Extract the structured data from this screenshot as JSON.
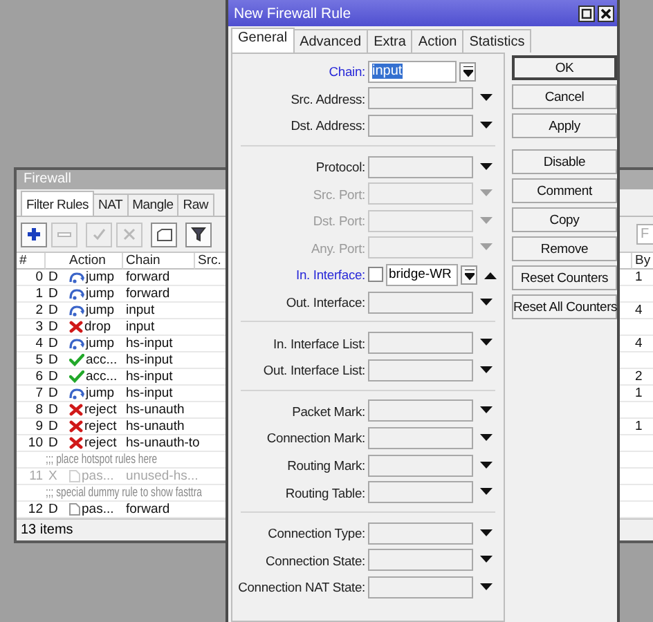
{
  "firewall": {
    "title": "Firewall",
    "tabs": [
      {
        "label": "Filter Rules",
        "selected": true
      },
      {
        "label": "NAT",
        "selected": false
      },
      {
        "label": "Mangle",
        "selected": false
      },
      {
        "label": "Raw",
        "selected": false
      }
    ],
    "toolbar": [
      {
        "kind": "add",
        "disabled": false
      },
      {
        "kind": "remove",
        "disabled": true
      },
      {
        "kind": "enable",
        "disabled": true
      },
      {
        "kind": "disable",
        "disabled": true
      },
      {
        "kind": "comment",
        "disabled": false
      },
      {
        "kind": "filter",
        "disabled": false
      }
    ],
    "find_placeholder": "F",
    "columns": [
      "#",
      "Action",
      "Chain",
      "Src.",
      "By"
    ],
    "rows": [
      {
        "kind": "rule",
        "number": "0",
        "flags": "D",
        "action": {
          "kind": "jump",
          "label": "jump"
        },
        "chain": "forward",
        "bytes": "1",
        "disabled": false
      },
      {
        "kind": "rule",
        "number": "1",
        "flags": "D",
        "action": {
          "kind": "jump",
          "label": "jump"
        },
        "chain": "forward",
        "disabled": false
      },
      {
        "kind": "rule",
        "number": "2",
        "flags": "D",
        "action": {
          "kind": "jump",
          "label": "jump"
        },
        "chain": "input",
        "bytes": "4",
        "disabled": false
      },
      {
        "kind": "rule",
        "number": "3",
        "flags": "D",
        "action": {
          "kind": "drop",
          "label": "drop"
        },
        "chain": "input",
        "disabled": false
      },
      {
        "kind": "rule",
        "number": "4",
        "flags": "D",
        "action": {
          "kind": "jump",
          "label": "jump"
        },
        "chain": "hs-input",
        "bytes": "4",
        "disabled": false
      },
      {
        "kind": "rule",
        "number": "5",
        "flags": "D",
        "action": {
          "kind": "accept",
          "label": "acc..."
        },
        "chain": "hs-input",
        "disabled": false
      },
      {
        "kind": "rule",
        "number": "6",
        "flags": "D",
        "action": {
          "kind": "accept",
          "label": "acc..."
        },
        "chain": "hs-input",
        "bytes": "2",
        "disabled": false
      },
      {
        "kind": "rule",
        "number": "7",
        "flags": "D",
        "action": {
          "kind": "jump",
          "label": "jump"
        },
        "chain": "hs-input",
        "bytes": "1",
        "disabled": false
      },
      {
        "kind": "rule",
        "number": "8",
        "flags": "D",
        "action": {
          "kind": "reject",
          "label": "reject"
        },
        "chain": "hs-unauth",
        "disabled": false
      },
      {
        "kind": "rule",
        "number": "9",
        "flags": "D",
        "action": {
          "kind": "reject",
          "label": "reject"
        },
        "chain": "hs-unauth",
        "bytes": "1",
        "disabled": false
      },
      {
        "kind": "rule",
        "number": "10",
        "flags": "D",
        "action": {
          "kind": "reject",
          "label": "reject"
        },
        "chain": "hs-unauth-to",
        "disabled": false
      },
      {
        "kind": "comment",
        "text": ";;; place hotspot rules here"
      },
      {
        "kind": "rule",
        "number": "11",
        "flags": "X",
        "action": {
          "kind": "passthrough",
          "label": "pas..."
        },
        "chain": "unused-hs...",
        "disabled": true
      },
      {
        "kind": "comment",
        "text": ";;; special dummy rule to show fasttra"
      },
      {
        "kind": "rule",
        "number": "12",
        "flags": "D",
        "action": {
          "kind": "passthrough",
          "label": "pas..."
        },
        "chain": "forward",
        "disabled": false
      }
    ],
    "status": "13 items"
  },
  "dialog": {
    "title": "New Firewall Rule",
    "tabs": [
      {
        "label": "General",
        "selected": true
      },
      {
        "label": "Advanced",
        "selected": false
      },
      {
        "label": "Extra",
        "selected": false
      },
      {
        "label": "Action",
        "selected": false
      },
      {
        "label": "Statistics",
        "selected": false
      }
    ],
    "groups": [
      [
        {
          "label": "Chain:",
          "kind": "select",
          "value": "input",
          "value_selected": true,
          "highlighted": true,
          "disabled": false
        },
        {
          "label": "Src. Address:",
          "kind": "combo",
          "highlighted": false,
          "disabled": false,
          "expanded": false
        },
        {
          "label": "Dst. Address:",
          "kind": "combo",
          "highlighted": false,
          "disabled": false,
          "expanded": false
        }
      ],
      [
        {
          "label": "Protocol:",
          "kind": "combo",
          "highlighted": false,
          "disabled": false,
          "expanded": false
        },
        {
          "label": "Src. Port:",
          "kind": "combo",
          "highlighted": false,
          "disabled": true,
          "expanded": false
        },
        {
          "label": "Dst. Port:",
          "kind": "combo",
          "highlighted": false,
          "disabled": true,
          "expanded": false
        },
        {
          "label": "Any. Port:",
          "kind": "combo",
          "highlighted": false,
          "disabled": true,
          "expanded": false
        },
        {
          "label": "In. Interface:",
          "kind": "negatable",
          "value": "bridge-WR",
          "negated": false,
          "highlighted": true,
          "disabled": false,
          "expanded": true
        },
        {
          "label": "Out. Interface:",
          "kind": "combo",
          "highlighted": false,
          "disabled": false,
          "expanded": false
        }
      ],
      [
        {
          "label": "In. Interface List:",
          "kind": "combo",
          "highlighted": false,
          "disabled": false,
          "expanded": false
        },
        {
          "label": "Out. Interface List:",
          "kind": "combo",
          "highlighted": false,
          "disabled": false,
          "expanded": false
        }
      ],
      [
        {
          "label": "Packet Mark:",
          "kind": "combo",
          "highlighted": false,
          "disabled": false,
          "expanded": false
        },
        {
          "label": "Connection Mark:",
          "kind": "combo",
          "highlighted": false,
          "disabled": false,
          "expanded": false
        },
        {
          "label": "Routing Mark:",
          "kind": "combo",
          "highlighted": false,
          "disabled": false,
          "expanded": false
        },
        {
          "label": "Routing Table:",
          "kind": "combo",
          "highlighted": false,
          "disabled": false,
          "expanded": false
        }
      ],
      [
        {
          "label": "Connection Type:",
          "kind": "combo",
          "highlighted": false,
          "disabled": false,
          "expanded": false
        },
        {
          "label": "Connection State:",
          "kind": "combo",
          "highlighted": false,
          "disabled": false,
          "expanded": false
        },
        {
          "label": "Connection NAT State:",
          "kind": "combo",
          "highlighted": false,
          "disabled": false,
          "expanded": false
        }
      ]
    ],
    "buttons": [
      [
        {
          "label": "OK",
          "default": true
        },
        {
          "label": "Cancel",
          "default": false
        },
        {
          "label": "Apply",
          "default": false
        }
      ],
      [
        {
          "label": "Disable",
          "default": false
        },
        {
          "label": "Comment",
          "default": false
        },
        {
          "label": "Copy",
          "default": false
        },
        {
          "label": "Remove",
          "default": false
        },
        {
          "label": "Reset Counters",
          "default": false
        },
        {
          "label": "Reset All Counters",
          "default": false
        }
      ]
    ]
  }
}
